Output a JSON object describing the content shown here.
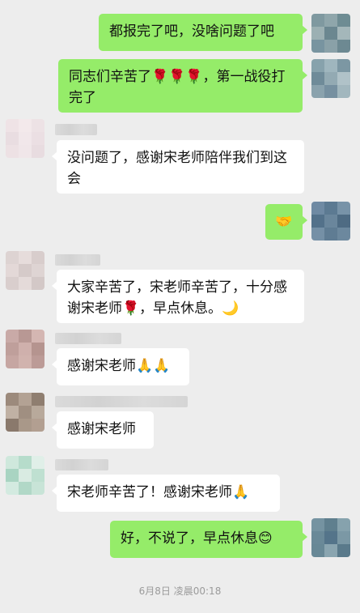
{
  "messages": [
    {
      "text": "都报完了吧，没啥问题了吧"
    },
    {
      "text": "同志们辛苦了🌹🌹🌹，第一战役打完了"
    },
    {
      "text": "没问题了，感谢宋老师陪伴我们到这会"
    },
    {
      "text": "🤝"
    },
    {
      "text": "大家辛苦了，宋老师辛苦了，十分感谢宋老师🌹，早点休息。🌙"
    },
    {
      "text": "感谢宋老师🙏🙏"
    },
    {
      "text": "感谢宋老师"
    },
    {
      "text": "宋老师辛苦了！感谢宋老师🙏"
    },
    {
      "text": "好，不说了，早点休息😊"
    }
  ],
  "timestamp": "6月8日 凌晨00:18",
  "colors": {
    "background": "#ededed",
    "outgoing_bubble": "#95ec69",
    "incoming_bubble": "#ffffff"
  }
}
